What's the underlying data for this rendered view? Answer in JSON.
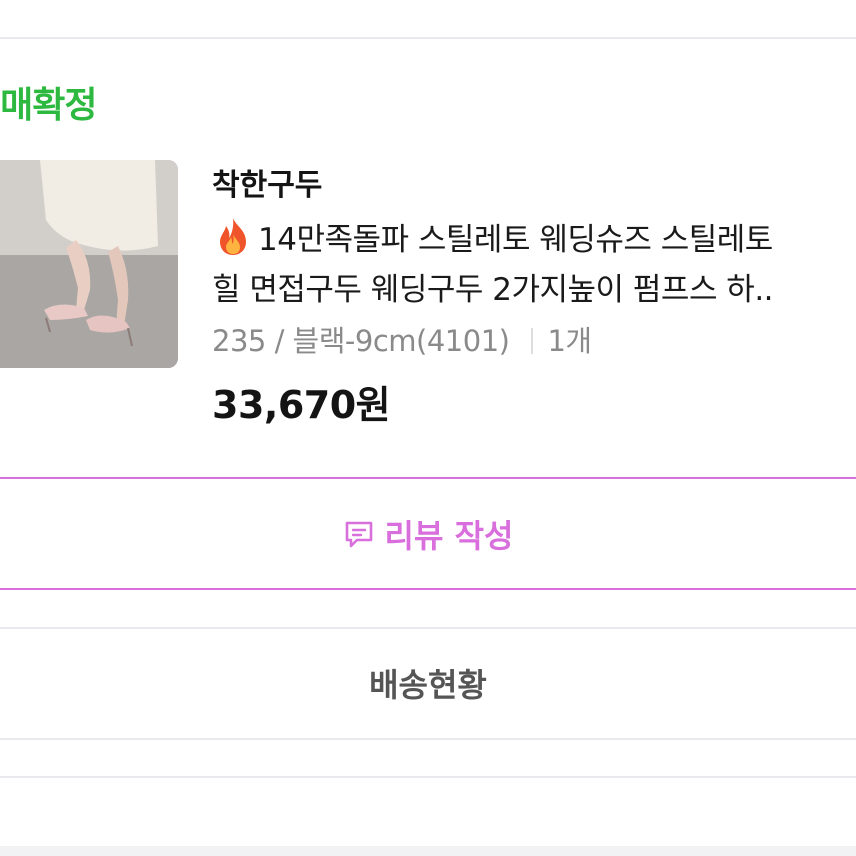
{
  "order": {
    "status": "구매확정",
    "shop_name": "착한구두",
    "title_line1": "14만족돌파 스틸레토 웨딩슈즈 스틸레토",
    "title_line2": "힐 면접구두 웨딩구두 2가지높이 펌프스 하..",
    "title_icon": "fire-emoji",
    "option_text": "235 / 블랙-9cm(4101)",
    "quantity": "1개",
    "price": "33,670원",
    "thumbnail": "product-photo (pink stiletto pumps)"
  },
  "actions": {
    "review_label": "리뷰 작성",
    "review_icon": "review-chat-icon",
    "shipping_label": "배송현황"
  },
  "colors": {
    "status_green": "#2db83f",
    "review_pink": "#d86fdc",
    "divider": "#e9e9ee"
  }
}
